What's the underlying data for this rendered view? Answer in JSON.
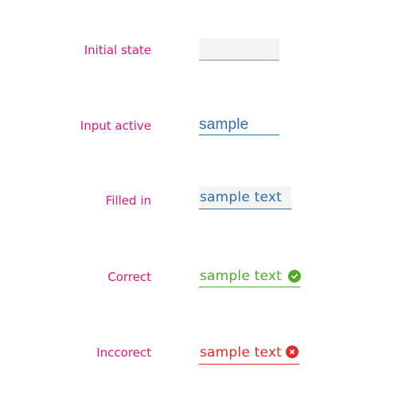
{
  "rows": [
    {
      "id": "initial",
      "label": "Initial state",
      "value": "",
      "state_color": "#7e95ad"
    },
    {
      "id": "active",
      "label": "Input active",
      "value": "sample",
      "state_color": "#2c6fb7"
    },
    {
      "id": "filled",
      "label": "Filled in",
      "value": "sample  text",
      "state_color": "#2c6fb7"
    },
    {
      "id": "correct",
      "label": "Correct",
      "value": "sample  text",
      "state_color": "#51a82b",
      "icon": "check-circle-icon"
    },
    {
      "id": "incorrect",
      "label": "Inccorect",
      "value": "sample text",
      "state_color": "#e32b2b",
      "icon": "error-circle-icon"
    }
  ],
  "theme": {
    "label_color": "#e0187a",
    "field_bg": "#f4f4f4"
  }
}
